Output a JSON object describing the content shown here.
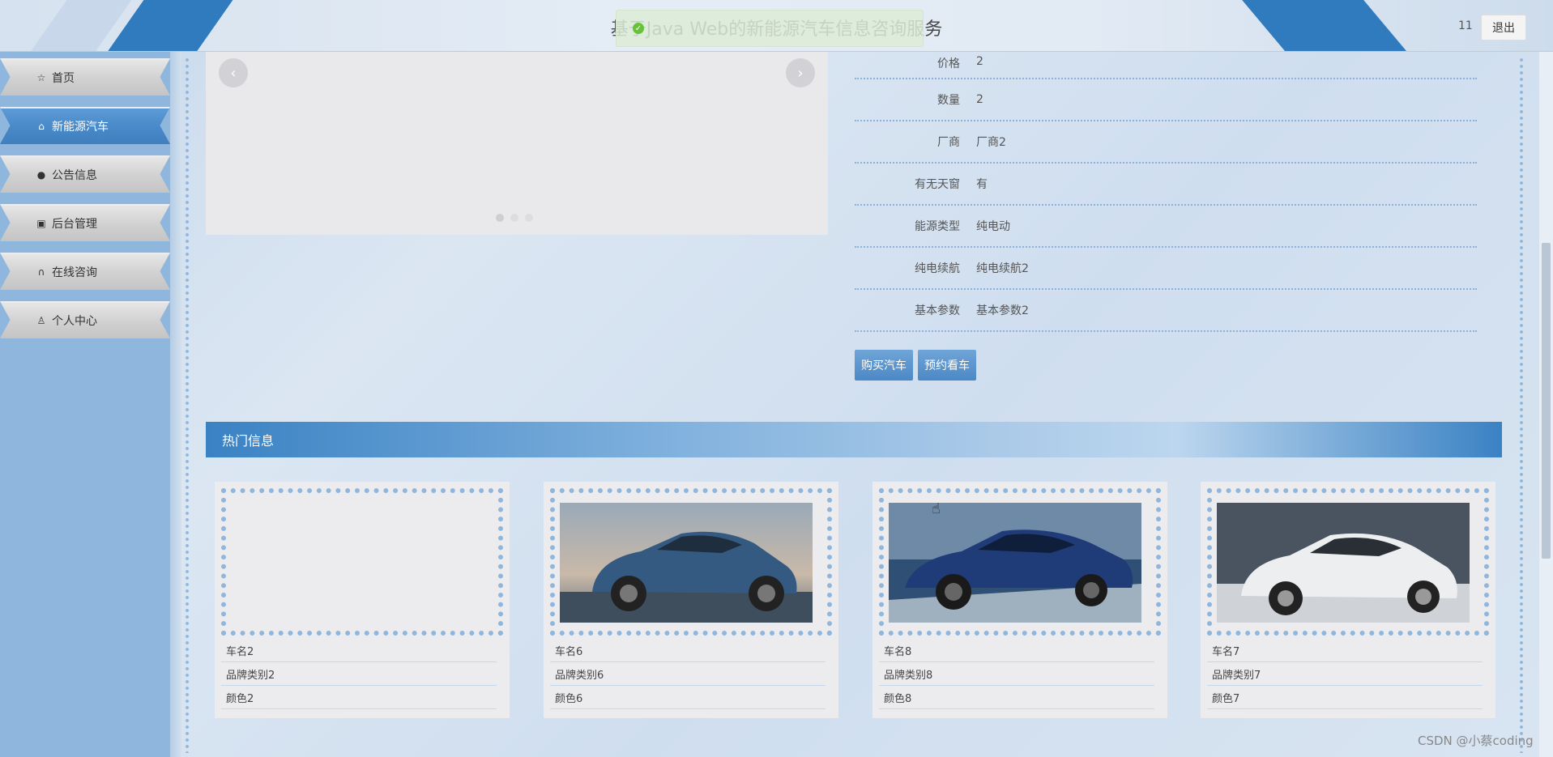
{
  "header": {
    "title": "基于Java Web的新能源汽车信息咨询服务",
    "toast": "",
    "user": "11",
    "logout_label": "退出"
  },
  "sidebar": {
    "items": [
      {
        "label": "首页",
        "icon": "star-icon"
      },
      {
        "label": "新能源汽车",
        "icon": "bag-icon"
      },
      {
        "label": "公告信息",
        "icon": "info-icon"
      },
      {
        "label": "后台管理",
        "icon": "briefcase-icon"
      },
      {
        "label": "在线咨询",
        "icon": "headset-icon"
      },
      {
        "label": "个人中心",
        "icon": "user-icon"
      }
    ]
  },
  "detail": {
    "rows": [
      {
        "label": "价格",
        "value": "2"
      },
      {
        "label": "数量",
        "value": "2"
      },
      {
        "label": "厂商",
        "value": "厂商2"
      },
      {
        "label": "有无天窗",
        "value": "有"
      },
      {
        "label": "能源类型",
        "value": "纯电动"
      },
      {
        "label": "纯电续航",
        "value": "纯电续航2"
      },
      {
        "label": "基本参数",
        "value": "基本参数2"
      }
    ],
    "buy_label": "购买汽车",
    "book_label": "预约看车"
  },
  "hot": {
    "title": "热门信息",
    "cards": [
      {
        "name": "车名2",
        "brand": "品牌类别2",
        "color": "颜色2",
        "image": "none"
      },
      {
        "name": "车名6",
        "brand": "品牌类别6",
        "color": "颜色6",
        "image": "blue-suv"
      },
      {
        "name": "车名8",
        "brand": "品牌类别8",
        "color": "颜色8",
        "image": "blue-sedan"
      },
      {
        "name": "车名7",
        "brand": "品牌类别7",
        "color": "颜色7",
        "image": "white-sedan"
      }
    ]
  },
  "watermark": "CSDN @小蔡coding",
  "colors": {
    "accent": "#3a82c4",
    "sidebar": "#8fb6dd",
    "active": "#4a8ac9"
  }
}
